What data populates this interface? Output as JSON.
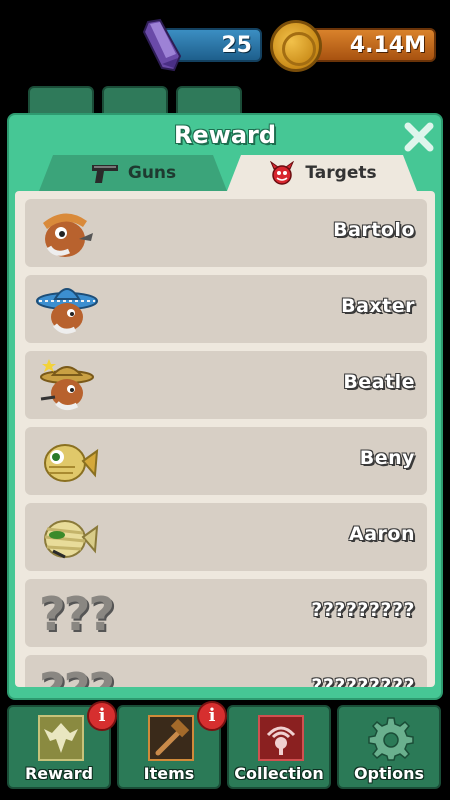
{
  "currency": {
    "gems": "25",
    "coins": "4.14M"
  },
  "modal": {
    "title": "Reward",
    "tabs": [
      {
        "label": "Guns",
        "icon": "pistol-icon",
        "active": false
      },
      {
        "label": "Targets",
        "icon": "devil-icon",
        "active": true
      }
    ],
    "targets": [
      {
        "name": "Bartolo",
        "icon": "bartolo-character-icon"
      },
      {
        "name": "Baxter",
        "icon": "baxter-sombrero-character-icon"
      },
      {
        "name": "Beatle",
        "icon": "beatle-sheriff-character-icon"
      },
      {
        "name": "Beny",
        "icon": "beny-fish-character-icon"
      },
      {
        "name": "Aaron",
        "icon": "aaron-mummy-fish-character-icon"
      },
      {
        "name": "?????????",
        "icon": "unknown-icon",
        "placeholder": "???"
      },
      {
        "name": "?????????",
        "icon": "unknown-icon",
        "placeholder": "???"
      }
    ]
  },
  "nav": [
    {
      "label": "Reward",
      "icon": "eagle-emblem-icon",
      "badge": "i"
    },
    {
      "label": "Items",
      "icon": "hammer-icon",
      "badge": "i"
    },
    {
      "label": "Collection",
      "icon": "target-emblem-icon",
      "badge": ""
    },
    {
      "label": "Options",
      "icon": "gear-icon",
      "badge": ""
    }
  ],
  "colors": {
    "modal_bg": "#46c795",
    "panel_bg": "#eee8de",
    "row_bg": "#d7cfc5",
    "nav_bg": "#2b7a57",
    "badge": "#d62f2f"
  }
}
